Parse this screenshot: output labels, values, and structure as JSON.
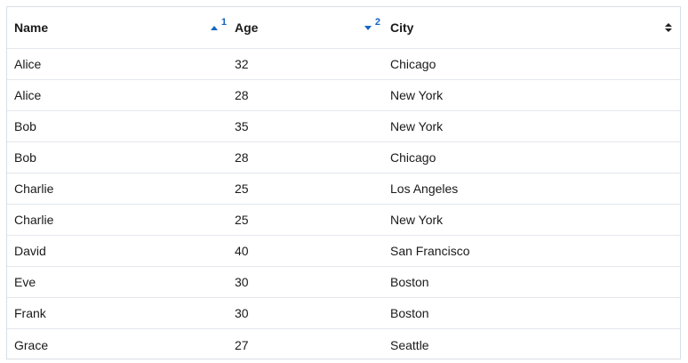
{
  "columns": [
    {
      "label": "Name",
      "sort": "asc",
      "sort_order": "1"
    },
    {
      "label": "Age",
      "sort": "desc",
      "sort_order": "2"
    },
    {
      "label": "City",
      "sort": "none",
      "sort_order": ""
    }
  ],
  "rows": [
    {
      "name": "Alice",
      "age": "32",
      "city": "Chicago"
    },
    {
      "name": "Alice",
      "age": "28",
      "city": "New York"
    },
    {
      "name": "Bob",
      "age": "35",
      "city": "New York"
    },
    {
      "name": "Bob",
      "age": "28",
      "city": "Chicago"
    },
    {
      "name": "Charlie",
      "age": "25",
      "city": "Los Angeles"
    },
    {
      "name": "Charlie",
      "age": "25",
      "city": "New York"
    },
    {
      "name": "David",
      "age": "40",
      "city": "San Francisco"
    },
    {
      "name": "Eve",
      "age": "30",
      "city": "Boston"
    },
    {
      "name": "Frank",
      "age": "30",
      "city": "Boston"
    },
    {
      "name": "Grace",
      "age": "27",
      "city": "Seattle"
    }
  ],
  "colors": {
    "accent": "#1565c0",
    "border": "#d9dee5"
  }
}
